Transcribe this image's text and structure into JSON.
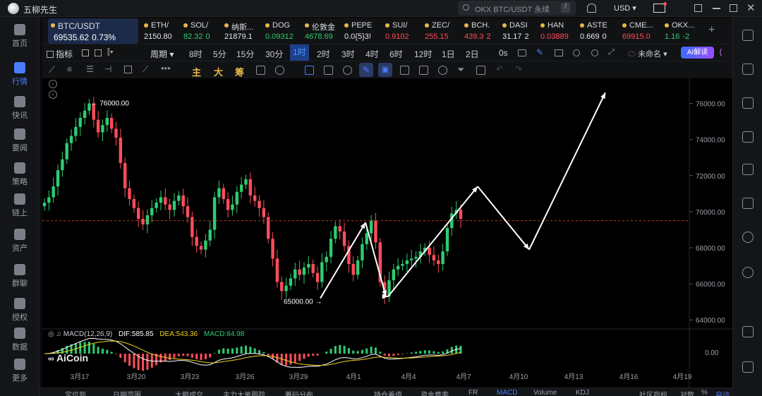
{
  "app": {
    "title": "五柳先生",
    "search_placeholder": "OKX BTC/USDT 永续",
    "search_key": "/",
    "currency": "USD"
  },
  "nav": [
    {
      "label": "首页",
      "icon": "home-icon"
    },
    {
      "label": "行情",
      "icon": "chart-bars-icon",
      "active": true
    },
    {
      "label": "快讯",
      "icon": "news-icon"
    },
    {
      "label": "要闻",
      "icon": "document-icon"
    },
    {
      "label": "策略",
      "icon": "strategy-icon"
    },
    {
      "label": "链上",
      "icon": "chain-icon"
    },
    {
      "label": "资产",
      "icon": "wallet-icon"
    },
    {
      "label": "群聊",
      "icon": "chat-icon"
    },
    {
      "label": "授权",
      "icon": "key-icon"
    },
    {
      "label": "数据",
      "icon": "data-icon"
    },
    {
      "label": "更多",
      "icon": "more-icon"
    }
  ],
  "tickers": [
    {
      "name": "BTC/USDT",
      "price": "69535.62",
      "change": "0.73%",
      "dir": "up",
      "active": true
    },
    {
      "name": "ETH/",
      "price": "2150.80",
      "change": "",
      "dir": "none"
    },
    {
      "name": "SOL/",
      "price": "82.32",
      "change": "0",
      "dir": "up"
    },
    {
      "name": "纳斯...",
      "price": "21879.1",
      "change": "",
      "dir": "none"
    },
    {
      "name": "DOG",
      "price": "0.09312",
      "change": "",
      "dir": "up"
    },
    {
      "name": "伦敦金",
      "price": "4678.69",
      "change": "",
      "dir": "up"
    },
    {
      "name": "PEPE",
      "price": "0.0{5}3!",
      "change": "",
      "dir": "none"
    },
    {
      "name": "SUI/",
      "price": "0.9102",
      "change": "",
      "dir": "dn"
    },
    {
      "name": "ZEC/",
      "price": "255.15",
      "change": "",
      "dir": "dn"
    },
    {
      "name": "BCH.",
      "price": "439.3",
      "change": "2",
      "dir": "dn"
    },
    {
      "name": "DASI",
      "price": "31.17",
      "change": "2",
      "dir": "none"
    },
    {
      "name": "HAN",
      "price": "0.03889",
      "change": "",
      "dir": "dn"
    },
    {
      "name": "ASTE",
      "price": "0.669",
      "change": "0",
      "dir": "none"
    },
    {
      "name": "CME...",
      "price": "69915.0",
      "change": "",
      "dir": "dn"
    },
    {
      "name": "OKX...",
      "price": "1.16",
      "change": "-2",
      "dir": "up"
    }
  ],
  "timeframe": {
    "indicator_label": "指标",
    "period_label": "周期",
    "items": [
      "8时",
      "5分",
      "15分",
      "30分",
      "1时",
      "2时",
      "3时",
      "4时",
      "6时",
      "12时",
      "1日",
      "2日"
    ],
    "active": "1时",
    "os_label": "0s",
    "unnamed_label": "未命名",
    "ai_label": "AI解读"
  },
  "toolbar_chars": [
    "主",
    "大",
    "筹"
  ],
  "chart_data": {
    "type": "line",
    "ylim": [
      63500,
      77000
    ],
    "yticks": [
      "76000.00",
      "74000.00",
      "72000.00",
      "70000.00",
      "68000.00",
      "66000.00",
      "64000.00"
    ],
    "xticks": [
      "3月17",
      "3月20",
      "3月23",
      "3月26",
      "3月29",
      "4月1",
      "4月4",
      "4月7",
      "4月10",
      "4月13",
      "4月16",
      "4月19"
    ],
    "annotations": {
      "high": "76000.00",
      "low": "65000.00"
    },
    "current_price_line": 69500,
    "closes": [
      70500,
      70800,
      71400,
      72300,
      72900,
      73800,
      74200,
      74700,
      75200,
      75600,
      76000,
      75100,
      74400,
      74800,
      75200,
      74600,
      74100,
      72700,
      71300,
      70700,
      70200,
      69600,
      69300,
      69800,
      70200,
      70500,
      70800,
      70400,
      70100,
      70600,
      70900,
      70300,
      69700,
      68600,
      68100,
      67900,
      68400,
      69000,
      70800,
      71300,
      70700,
      70100,
      70400,
      71100,
      71500,
      71800,
      70900,
      70600,
      70200,
      69700,
      68500,
      67400,
      66100,
      65600,
      65900,
      66300,
      66800,
      66500,
      66900,
      67100,
      66600,
      66100,
      67200,
      67500,
      68500,
      69200,
      68900,
      68100,
      67100,
      66500,
      67300,
      68200,
      68800,
      69500,
      68300,
      66100,
      65300,
      66200,
      66800,
      67000,
      67100,
      67300,
      67400,
      67500,
      67800,
      68000,
      67600,
      67300,
      67100,
      67800,
      69100,
      69900,
      70100,
      69600
    ],
    "projection": [
      [
        "4月2",
        65300
      ],
      [
        "4月6",
        71400
      ],
      [
        "4月9",
        67900
      ],
      [
        "4月15",
        76600
      ]
    ],
    "macd": {
      "label": "MACD(12,26,9)",
      "dif": "DIF:585.85",
      "dea": "DEA:543.36",
      "macd": "MACD:84.98",
      "zero": "0.00"
    }
  },
  "watermark": "AiCoin",
  "bottom_tabs": [
    "定位到...",
    "日期范围",
    "大额成交",
    "主力大单跟踪",
    "筹码分布",
    "持仓着值",
    "资金费率",
    "FR",
    "MACD",
    "Volume",
    "KDJ",
    "社区指标",
    "对数",
    "%",
    "自动"
  ]
}
